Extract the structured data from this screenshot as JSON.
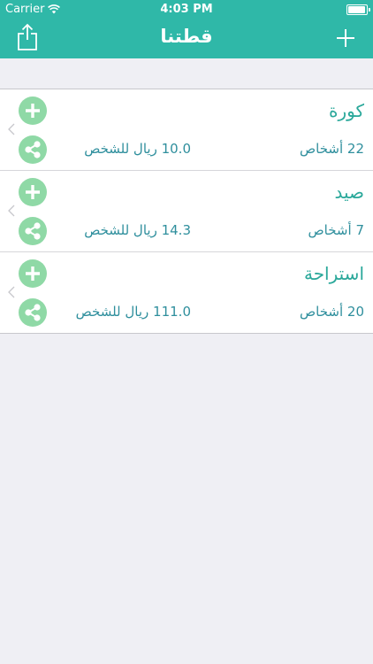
{
  "status_bar": {
    "carrier": "Carrier",
    "time": "4:03 PM"
  },
  "nav": {
    "title": "قطتنا",
    "share_icon": "share-icon",
    "add_icon": "plus-icon"
  },
  "colors": {
    "accent": "#2fb8a8",
    "button_green": "#8fd9a6",
    "name_text": "#2aa89a",
    "detail_text": "#2f8f9d",
    "background": "#efeff4"
  },
  "rows": [
    {
      "name": "كورة",
      "people": "22 أشخاص",
      "price": "10.0 ريال للشخص"
    },
    {
      "name": "صيد",
      "people": "7 أشخاص",
      "price": "14.3 ريال للشخص"
    },
    {
      "name": "استراحة",
      "people": "20 أشخاص",
      "price": "111.0 ريال للشخص"
    }
  ]
}
